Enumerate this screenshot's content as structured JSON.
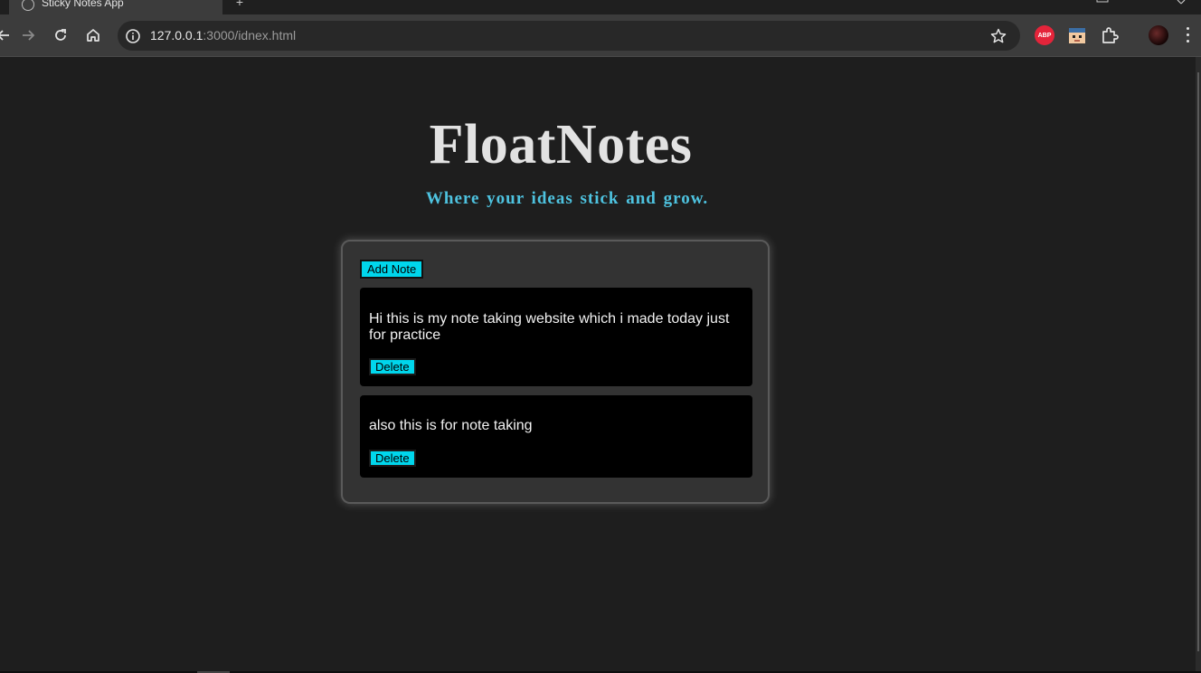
{
  "browser": {
    "tab_title": "Sticky Notes App",
    "new_tab_label": "+",
    "url_host": "127.0.0.1",
    "url_rest": ":3000/idnex.html",
    "extensions": [
      "adblock-plus-icon",
      "pixel-face-extension-icon",
      "extensions-puzzle-icon"
    ],
    "abp_label": "ABP"
  },
  "app": {
    "title": "FloatNotes",
    "subtitle": "Where your ideas stick and grow.",
    "add_note_label": "Add Note",
    "notes": [
      {
        "text": "Hi this is my note taking website which i made today just for practice",
        "delete_label": "Delete"
      },
      {
        "text": "also this is for note taking",
        "delete_label": "Delete"
      }
    ]
  },
  "colors": {
    "page_bg": "#1e1e1e",
    "container_bg": "#333333",
    "note_bg": "#000000",
    "accent": "#00d6ec",
    "subtitle": "#4ec3e0",
    "title": "#e2e2e2"
  }
}
